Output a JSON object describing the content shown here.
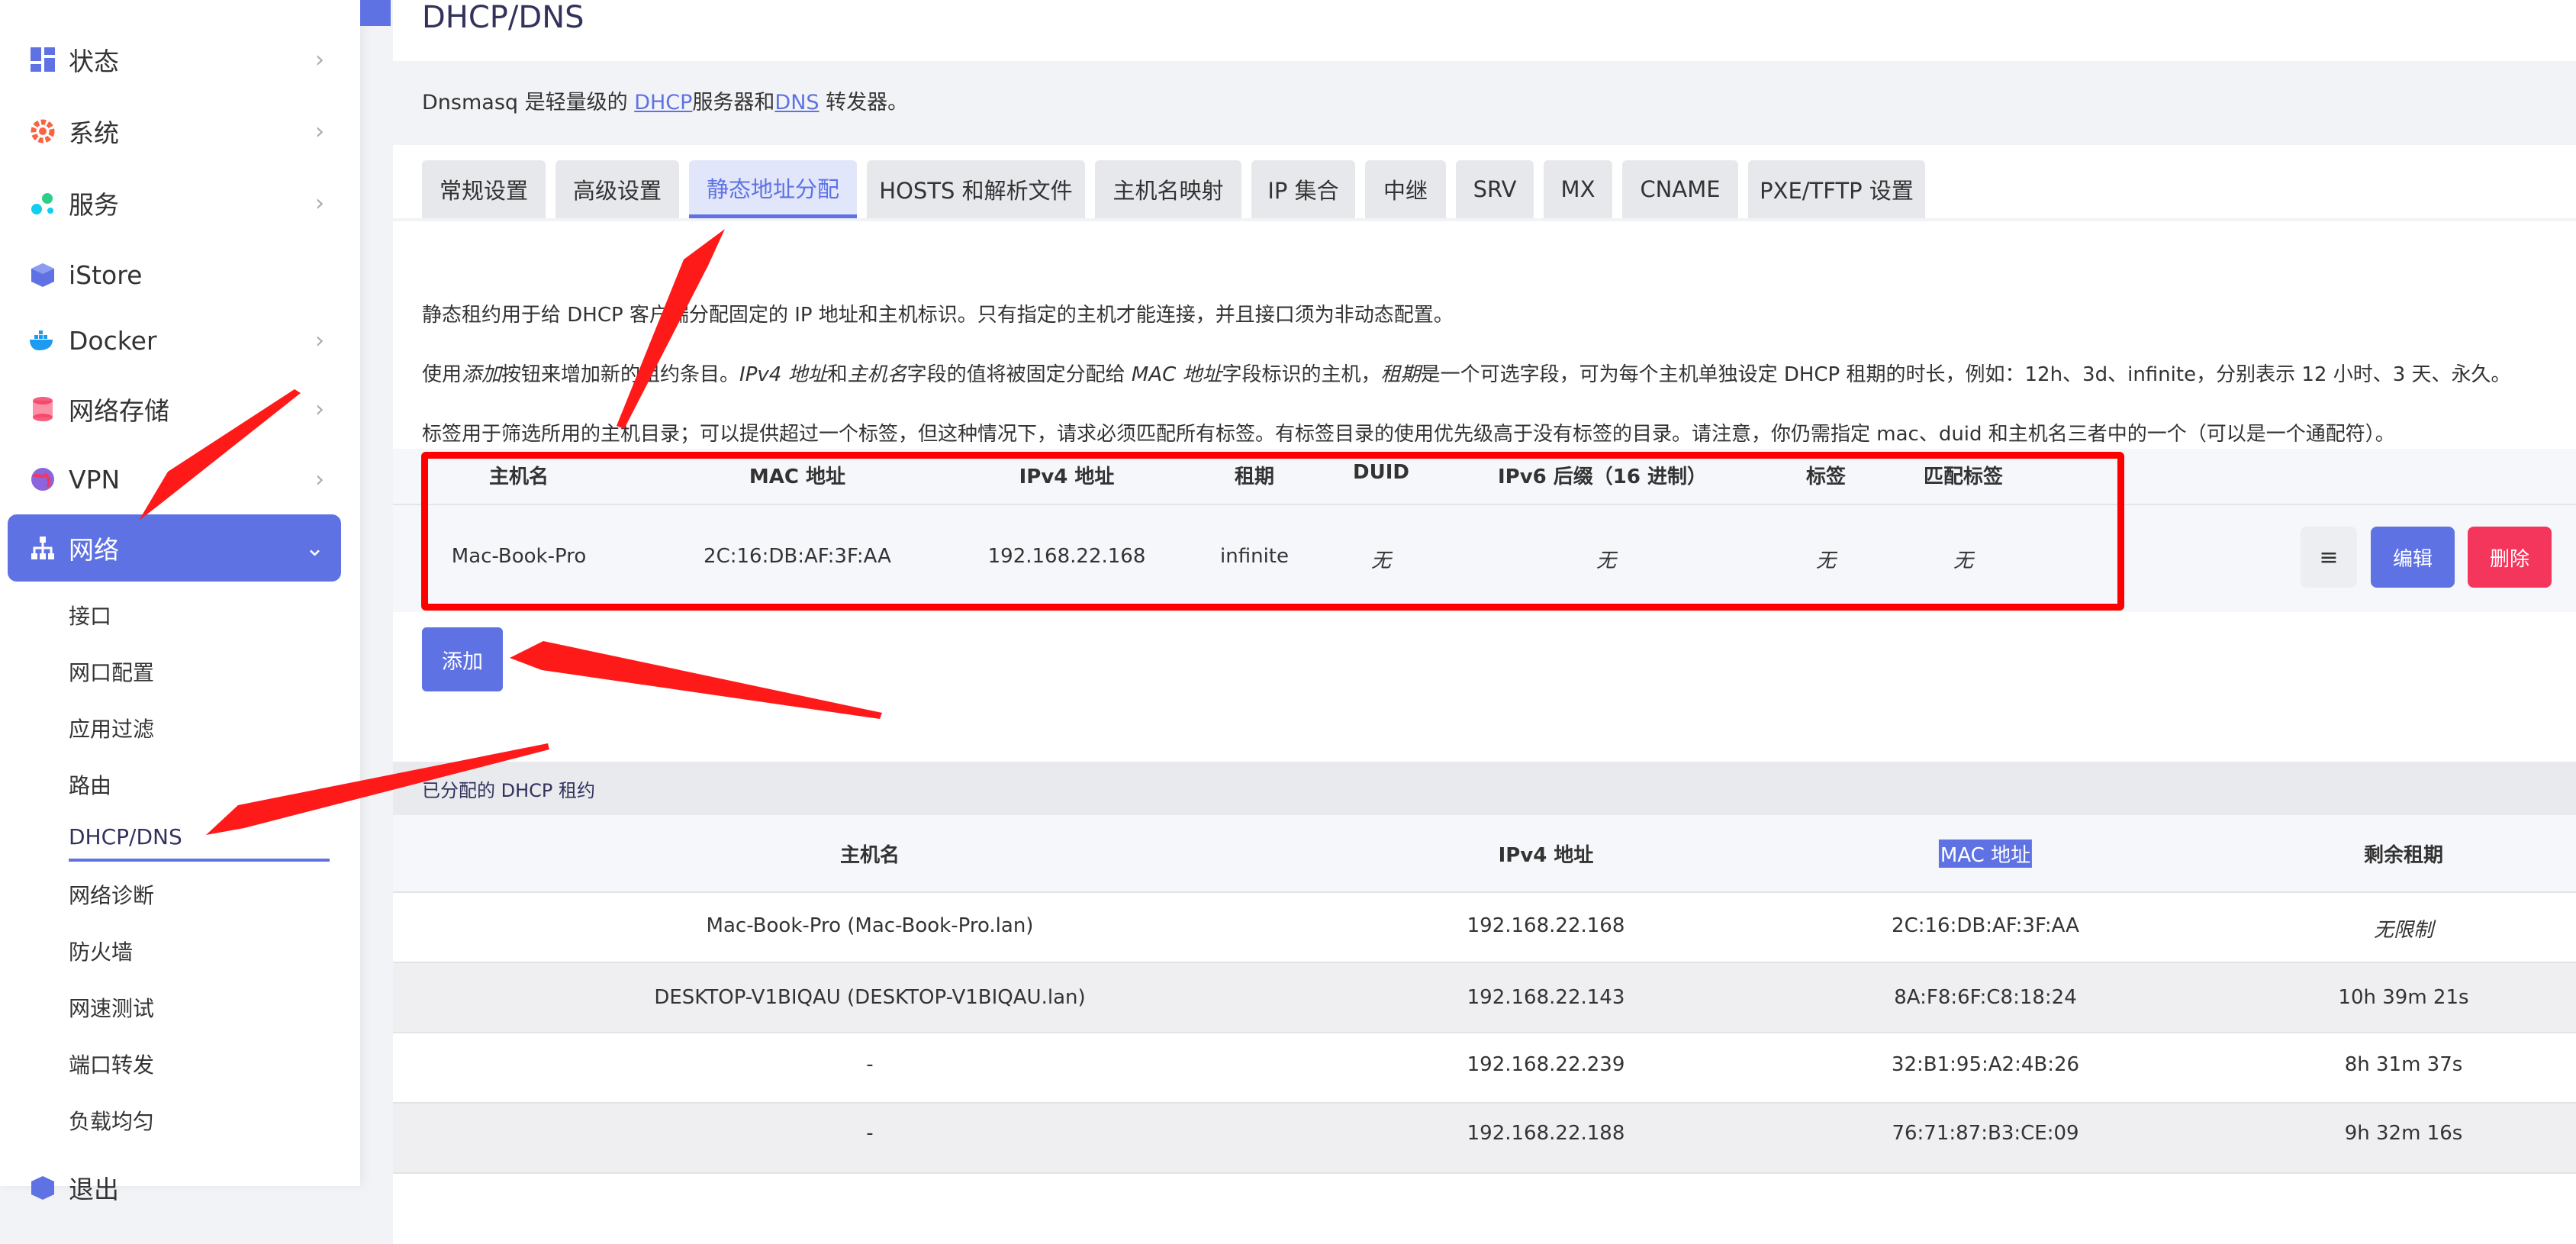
{
  "sidebar": {
    "items": [
      {
        "label": "状态",
        "icon": "dashboard-icon"
      },
      {
        "label": "系统",
        "icon": "gear-icon"
      },
      {
        "label": "服务",
        "icon": "puzzle-icon"
      },
      {
        "label": "iStore",
        "icon": "box-icon"
      },
      {
        "label": "Docker",
        "icon": "whale-icon"
      },
      {
        "label": "网络存储",
        "icon": "database-icon"
      },
      {
        "label": "VPN",
        "icon": "globe-icon"
      },
      {
        "label": "网络",
        "icon": "network-icon"
      }
    ],
    "sub_items": [
      "接口",
      "网口配置",
      "应用过滤",
      "路由",
      "DHCP/DNS",
      "网络诊断",
      "防火墙",
      "网速测试",
      "端口转发",
      "负载均匀",
      "退出"
    ],
    "accent": "#5e72e4"
  },
  "page": {
    "title": "DHCP/DNS",
    "desc_prefix": "Dnsmasq 是轻量级的 ",
    "desc_link1": "DHCP",
    "desc_mid": "服务器和",
    "desc_link2": "DNS",
    "desc_suffix": " 转发器。"
  },
  "tabs": [
    "常规设置",
    "高级设置",
    "静态地址分配",
    "HOSTS 和解析文件",
    "主机名映射",
    "IP 集合",
    "中继",
    "SRV",
    "MX",
    "CNAME",
    "PXE/TFTP 设置"
  ],
  "info": {
    "line1": "静态租约用于给 DHCP 客户端分配固定的 IP 地址和主机标识。只有指定的主机才能连接，并且接口须为非动态配置。",
    "line2_a": "使用",
    "line2_b": "添加",
    "line2_c": "按钮来增加新的租约条目。",
    "line2_d": "IPv4 地址",
    "line2_e": "和",
    "line2_f": "主机名",
    "line2_g": "字段的值将被固定分配给 ",
    "line2_h": "MAC 地址",
    "line2_i": "字段标识的主机，",
    "line2_j": "租期",
    "line2_k": "是一个可选字段，可为每个主机单独设定 DHCP 租期的时长，例如：12h、3d、infinite，分别表示 12 小时、3 天、永久。",
    "line3": "标签用于筛选所用的主机目录；可以提供超过一个标签，但这种情况下，请求必须匹配所有标签。有标签目录的使用优先级高于没有标签的目录。请注意，你仍需指定 mac、duid 和主机名三者中的一个（可以是一个通配符）。"
  },
  "static_leases": {
    "headers": [
      "主机名",
      "MAC 地址",
      "IPv4 地址",
      "租期",
      "DUID",
      "IPv6 后缀（16 进制）",
      "标签",
      "匹配标签"
    ],
    "rows": [
      [
        "Mac-Book-Pro",
        "2C:16:DB:AF:3F:AA",
        "192.168.22.168",
        "infinite",
        "无",
        "无",
        "无",
        "无"
      ]
    ],
    "menu_label": "≡",
    "edit_label": "编辑",
    "delete_label": "删除",
    "add_label": "添加"
  },
  "dhcp_leases": {
    "title": "已分配的 DHCP 租约",
    "headers": [
      "主机名",
      "IPv4 地址",
      "MAC 地址",
      "剩余租期"
    ],
    "rows": [
      [
        "Mac-Book-Pro (Mac-Book-Pro.lan)",
        "192.168.22.168",
        "2C:16:DB:AF:3F:AA",
        "无限制"
      ],
      [
        "DESKTOP-V1BIQAU (DESKTOP-V1BIQAU.lan)",
        "192.168.22.143",
        "8A:F8:6F:C8:18:24",
        "10h 39m 21s"
      ],
      [
        "-",
        "192.168.22.239",
        "32:B1:95:A2:4B:26",
        "8h 31m 37s"
      ],
      [
        "-",
        "192.168.22.188",
        "76:71:87:B3:CE:09",
        "9h 32m 16s"
      ]
    ]
  },
  "annotation_color": "#ff0000"
}
